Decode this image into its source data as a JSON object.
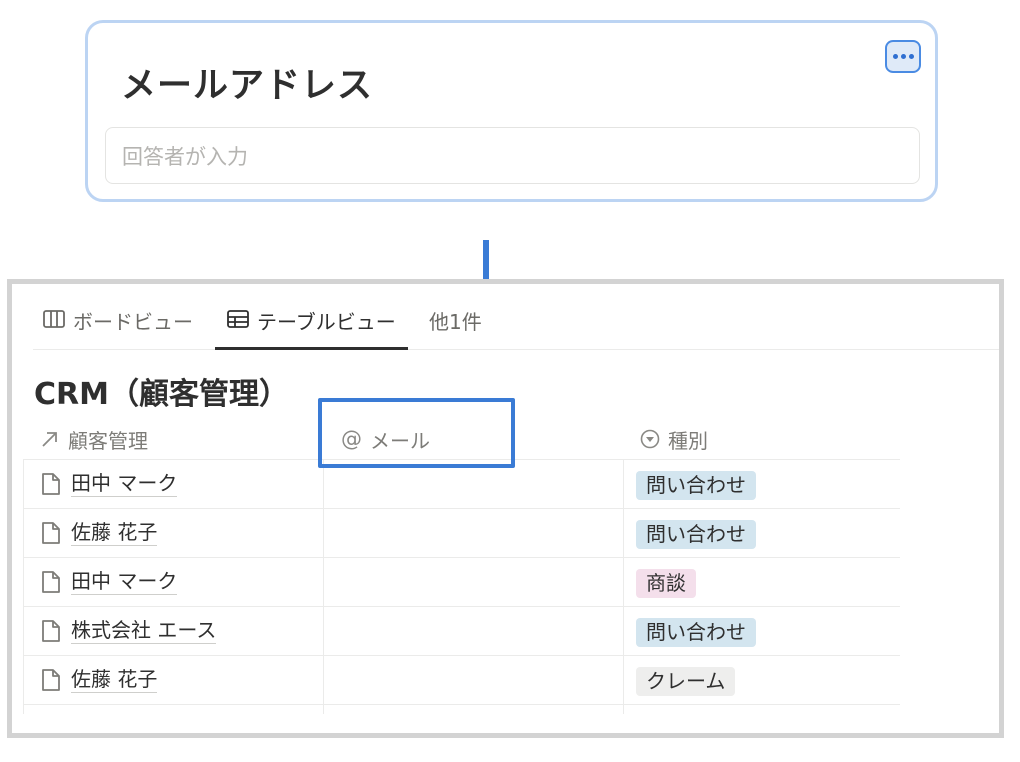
{
  "form": {
    "title": "メールアドレス",
    "answer_placeholder": "回答者が入力",
    "more_icon": "more-horizontal-icon"
  },
  "database": {
    "tabs": [
      {
        "label": "ボードビュー",
        "icon": "board-view-icon",
        "active": false
      },
      {
        "label": "テーブルビュー",
        "icon": "table-view-icon",
        "active": true
      },
      {
        "label": "他1件",
        "icon": "",
        "active": false
      }
    ],
    "title": "CRM（顧客管理）",
    "columns": [
      {
        "label": "顧客管理",
        "icon": "relation-arrow-icon"
      },
      {
        "label": "メール",
        "icon": "at-sign-icon"
      },
      {
        "label": "種別",
        "icon": "select-circle-icon"
      }
    ],
    "rows": [
      {
        "name": "田中 マーク",
        "email": "",
        "type": "問い合わせ"
      },
      {
        "name": "佐藤 花子",
        "email": "",
        "type": "問い合わせ"
      },
      {
        "name": "田中 マーク",
        "email": "",
        "type": "商談"
      },
      {
        "name": "株式会社 エース",
        "email": "",
        "type": "問い合わせ"
      },
      {
        "name": "佐藤 花子",
        "email": "",
        "type": "クレーム"
      }
    ],
    "tag_colors": {
      "問い合わせ": "#d3e5ef",
      "商談": "#f4dfeb",
      "クレーム": "#eeeeed"
    }
  },
  "annotation": {
    "arrow_color": "#3a7bd5",
    "highlight_color": "#3a7bd5"
  }
}
